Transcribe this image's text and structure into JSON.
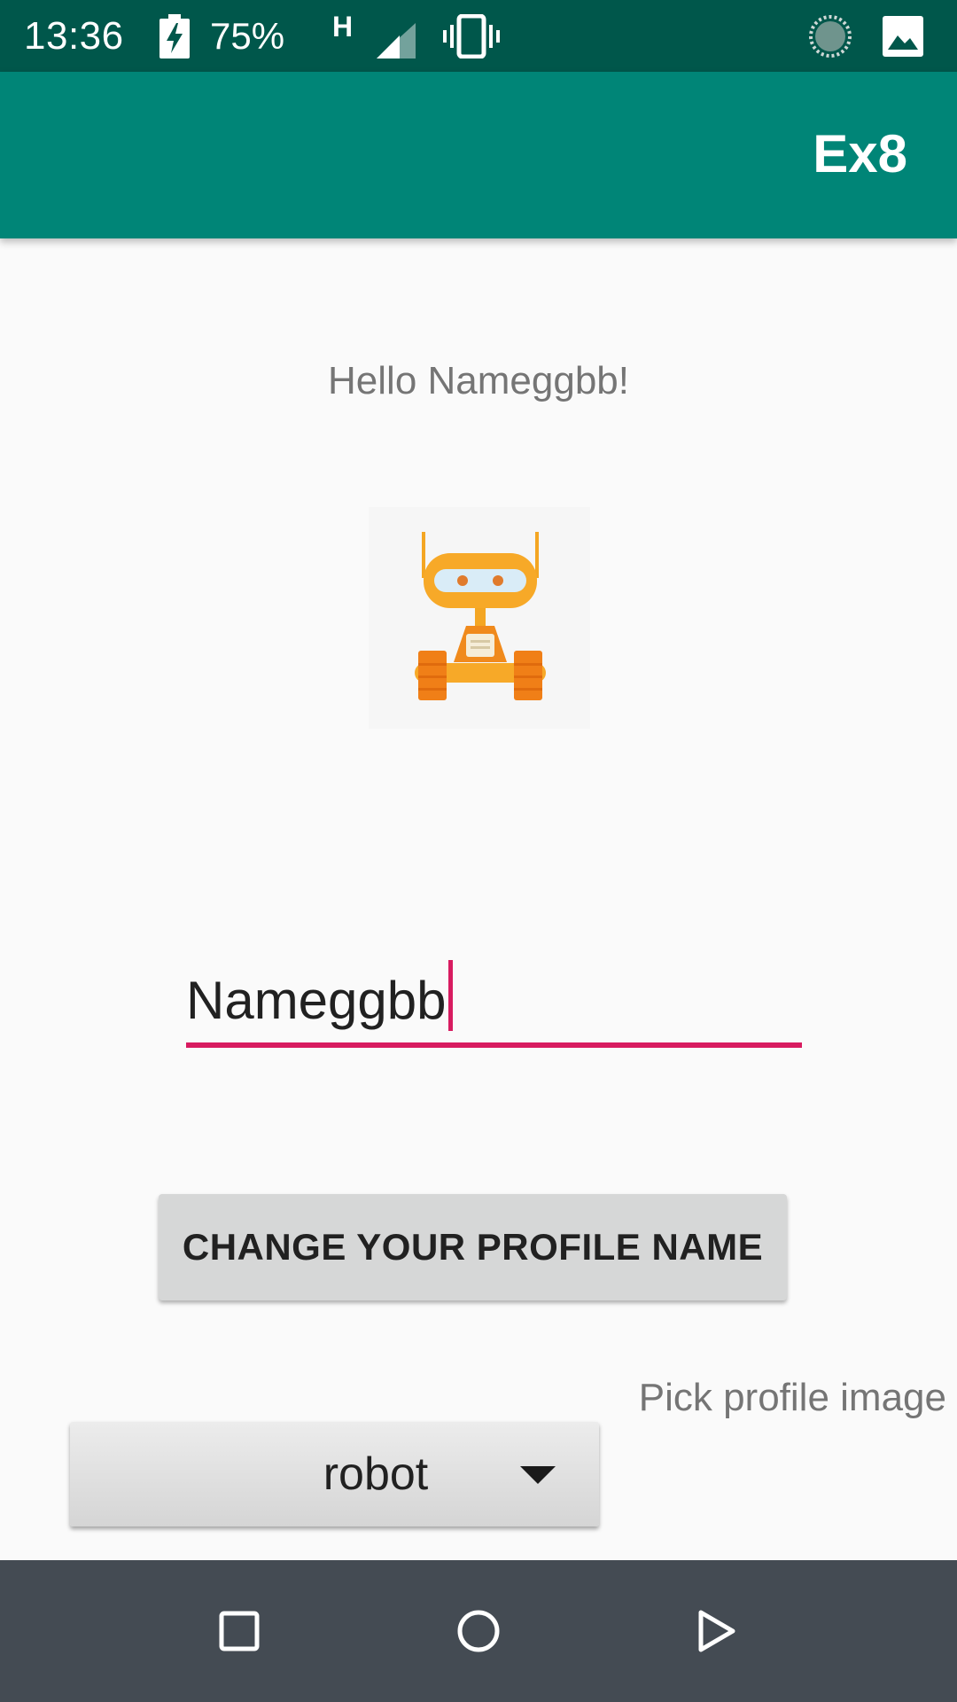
{
  "status_bar": {
    "time": "13:36",
    "battery_percent": "75%",
    "network_type": "H",
    "icons": [
      "battery-charging-icon",
      "signal-icon",
      "vibrate-icon",
      "sync-icon",
      "image-icon"
    ]
  },
  "app_bar": {
    "title": "Ex8",
    "color": "#008577"
  },
  "main": {
    "greeting": "Hello Nameggbb!",
    "profile_image_icon": "robot-icon",
    "name_input": {
      "value": "Nameggbb",
      "accent_color": "#d81b60"
    },
    "change_button_label": "CHANGE YOUR PROFILE NAME",
    "pick_label": "Pick profile image",
    "spinner": {
      "selected": "robot"
    }
  },
  "nav_bar": {
    "icons": [
      "recents-icon",
      "home-icon",
      "back-icon"
    ]
  }
}
